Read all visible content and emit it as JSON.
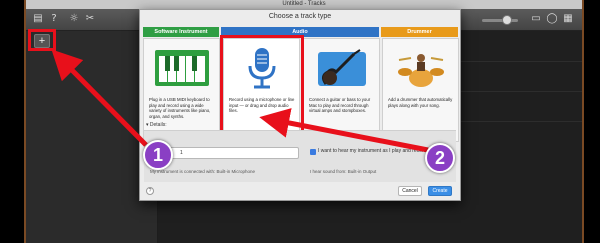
{
  "window": {
    "title": "Untitled - Tracks"
  },
  "toolbar": {
    "icons": [
      "library-icon",
      "help-icon",
      "smart-controls-icon",
      "scissors-icon"
    ],
    "right_icons": [
      "notepad-icon",
      "loops-icon",
      "browser-icon"
    ]
  },
  "sidebar": {
    "add_track_label": "+"
  },
  "dialog": {
    "title": "Choose a track type",
    "categories": [
      {
        "label": "Software Instrument",
        "color": "#2f9e44"
      },
      {
        "label": "Audio",
        "color": "#2f73c5"
      },
      {
        "label": "Drummer",
        "color": "#e89a1a"
      }
    ],
    "cards": [
      {
        "icon": "keyboard-icon",
        "description": "Plug in a USB MIDI keyboard to play and record using a wide variety of instruments like piano, organ, and synths."
      },
      {
        "icon": "microphone-icon",
        "description": "Record using a microphone or line input — or drag and drop audio files."
      },
      {
        "icon": "guitar-icon",
        "description": "Connect a guitar or bass to your Mac to play and record through virtual amps and stompboxes."
      },
      {
        "icon": "drummer-icon",
        "description": "Add a drummer that automatically plays along with your song."
      }
    ],
    "details_label": "Details:",
    "input_value": "1",
    "monitor_checkbox_label": "I want to hear my instrument as I play and record",
    "connection_text": "My instrument is connected with: Built-in Microphone",
    "hear_sound_text": "I hear sound from: Built-in Output",
    "help_label": "?",
    "cancel_label": "Cancel",
    "create_label": "Create"
  },
  "annotations": {
    "badge_1": "1",
    "badge_2": "2",
    "highlight_color": "#e8101b",
    "badge_color": "#8a3fc4"
  }
}
